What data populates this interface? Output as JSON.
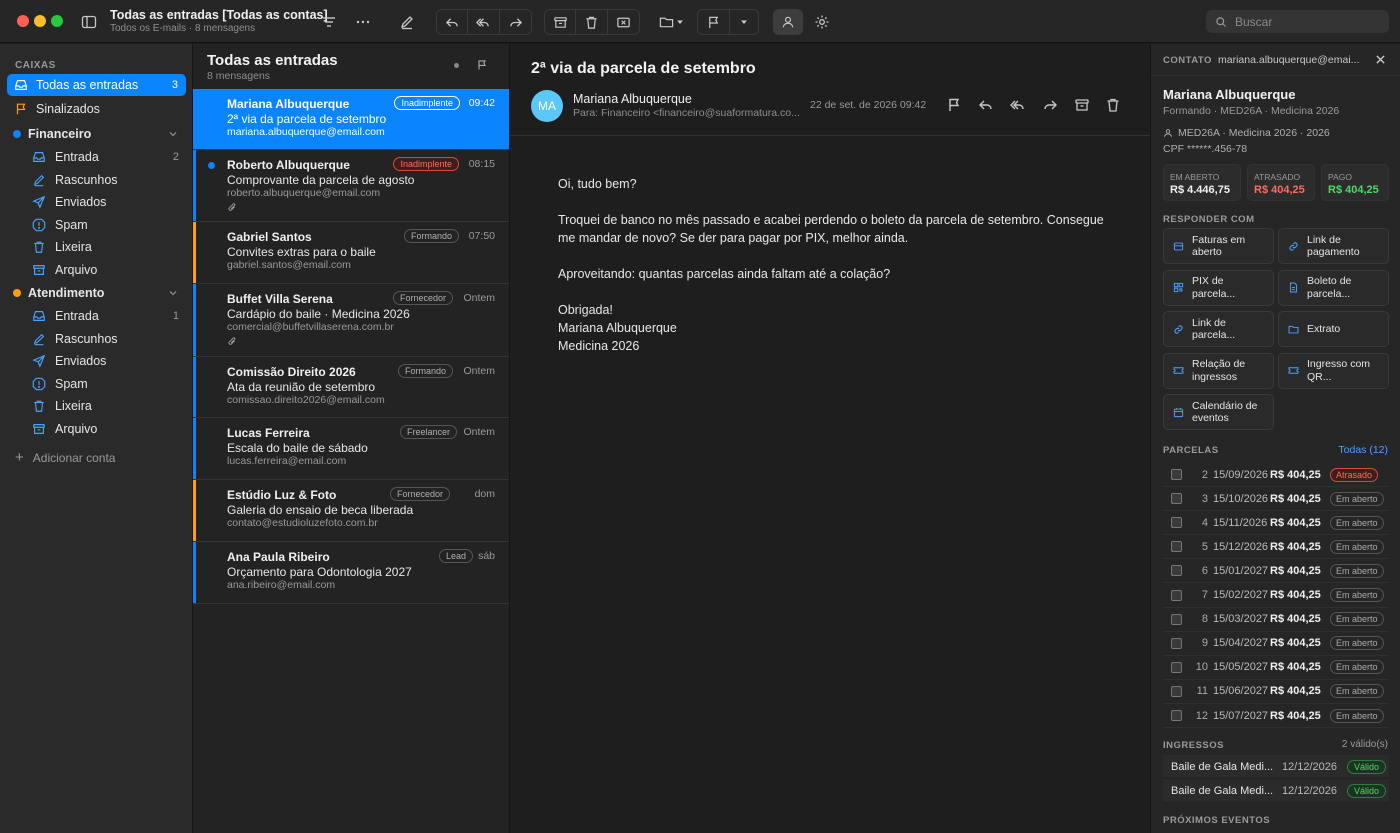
{
  "window": {
    "title": "Todas as entradas [Todas as contas]",
    "subtitle": "Todos os E-mails · 8 mensagens",
    "search_placeholder": "Buscar"
  },
  "colors": {
    "accent": "#0a84ff",
    "financeiro": "#0a84ff",
    "atendimento": "#ff9f0a",
    "danger": "#ff6b5e",
    "success": "#4cd964"
  },
  "sidebar": {
    "section_label": "CAIXAS",
    "all_inboxes": {
      "label": "Todas as entradas",
      "count": "3"
    },
    "flagged": {
      "label": "Sinalizados"
    },
    "accounts": [
      {
        "name": "Financeiro",
        "folders": [
          {
            "label": "Entrada",
            "icon": "inbox-icon",
            "count": "2"
          },
          {
            "label": "Rascunhos",
            "icon": "pencil-icon",
            "count": ""
          },
          {
            "label": "Enviados",
            "icon": "send-icon",
            "count": ""
          },
          {
            "label": "Spam",
            "icon": "spam-icon",
            "count": ""
          },
          {
            "label": "Lixeira",
            "icon": "trash-icon",
            "count": ""
          },
          {
            "label": "Arquivo",
            "icon": "archive-icon",
            "count": ""
          }
        ]
      },
      {
        "name": "Atendimento",
        "folders": [
          {
            "label": "Entrada",
            "icon": "inbox-icon",
            "count": "1"
          },
          {
            "label": "Rascunhos",
            "icon": "pencil-icon",
            "count": ""
          },
          {
            "label": "Enviados",
            "icon": "send-icon",
            "count": ""
          },
          {
            "label": "Spam",
            "icon": "spam-icon",
            "count": ""
          },
          {
            "label": "Lixeira",
            "icon": "trash-icon",
            "count": ""
          },
          {
            "label": "Arquivo",
            "icon": "archive-icon",
            "count": ""
          }
        ]
      }
    ],
    "add_account": "Adicionar conta"
  },
  "list": {
    "title": "Todas as entradas",
    "count": "8 mensagens",
    "messages": [
      {
        "from": "Mariana Albuquerque",
        "subject": "2ª via da parcela de setembro",
        "address": "mariana.albuquerque@email.com",
        "time": "09:42",
        "tag": "Inadimplente",
        "selected": true,
        "unread": false,
        "attachment": false,
        "bar": "#0a84ff"
      },
      {
        "from": "Roberto Albuquerque",
        "subject": "Comprovante da parcela de agosto",
        "address": "roberto.albuquerque@email.com",
        "time": "08:15",
        "tag": "Inadimplente",
        "selected": false,
        "unread": true,
        "attachment": true,
        "bar": "#0a84ff"
      },
      {
        "from": "Gabriel Santos",
        "subject": "Convites extras para o baile",
        "address": "gabriel.santos@email.com",
        "time": "07:50",
        "tag": "Formando",
        "selected": false,
        "unread": false,
        "attachment": false,
        "bar": "#ff9f0a"
      },
      {
        "from": "Buffet Villa Serena",
        "subject": "Cardápio do baile · Medicina 2026",
        "address": "comercial@buffetvillaserena.com.br",
        "time": "Ontem",
        "tag": "Fornecedor",
        "selected": false,
        "unread": false,
        "attachment": true,
        "bar": "#0a84ff"
      },
      {
        "from": "Comissão Direito 2026",
        "subject": "Ata da reunião de setembro",
        "address": "comissao.direito2026@email.com",
        "time": "Ontem",
        "tag": "Formando",
        "selected": false,
        "unread": false,
        "attachment": false,
        "bar": "#0a84ff"
      },
      {
        "from": "Lucas Ferreira",
        "subject": "Escala do baile de sábado",
        "address": "lucas.ferreira@email.com",
        "time": "Ontem",
        "tag": "Freelancer",
        "selected": false,
        "unread": false,
        "attachment": false,
        "bar": "#0a84ff"
      },
      {
        "from": "Estúdio Luz & Foto",
        "subject": "Galeria do ensaio de beca liberada",
        "address": "contato@estudioluzefoto.com.br",
        "time": "dom",
        "tag": "Fornecedor",
        "selected": false,
        "unread": false,
        "attachment": false,
        "bar": "#ff9f0a"
      },
      {
        "from": "Ana Paula Ribeiro",
        "subject": "Orçamento para Odontologia 2027",
        "address": "ana.ribeiro@email.com",
        "time": "sáb",
        "tag": "Lead",
        "selected": false,
        "unread": false,
        "attachment": false,
        "bar": "#0a84ff"
      }
    ]
  },
  "reader": {
    "subject": "2ª via da parcela de setembro",
    "avatar": "MA",
    "from": "Mariana Albuquerque",
    "to": "Para: Financeiro <financeiro@suaformatura.co...",
    "date": "22 de set. de 2026 09:42",
    "body": [
      [
        "Oi, tudo bem?"
      ],
      [
        "Troquei de banco no mês passado e acabei perdendo o boleto da parcela de setembro. Consegue",
        "me mandar de novo? Se der para pagar por PIX, melhor ainda."
      ],
      [
        "Aproveitando: quantas parcelas ainda faltam até a colação?"
      ],
      [
        "Obrigada!",
        "Mariana Albuquerque",
        "Medicina 2026"
      ]
    ]
  },
  "panel": {
    "header_label": "CONTATO",
    "header_email": "mariana.albuquerque@emai...",
    "name": "Mariana Albuquerque",
    "role": "Formando · MED26A · Medicina 2026",
    "class_info": "MED26A · Medicina 2026 · 2026",
    "cpf": "CPF ******.456-78",
    "stats": [
      {
        "label": "EM ABERTO",
        "value": "R$ 4.446,75",
        "color": "#f0f0f0"
      },
      {
        "label": "ATRASADO",
        "value": "R$ 404,25",
        "color": "#ff6b5e"
      },
      {
        "label": "PAGO",
        "value": "R$ 404,25",
        "color": "#4cd964"
      }
    ],
    "reply_label": "RESPONDER COM",
    "reply_buttons": [
      {
        "label": "Faturas em aberto",
        "lines": [
          "Faturas em",
          "aberto"
        ],
        "icon": "invoice-icon"
      },
      {
        "label": "Link de pagamento",
        "lines": [
          "Link de",
          "pagamento"
        ],
        "icon": "link-icon"
      },
      {
        "label": "PIX de parcela...",
        "lines": [
          "PIX de",
          "parcela..."
        ],
        "icon": "qr-icon"
      },
      {
        "label": "Boleto de parcela...",
        "lines": [
          "Boleto de",
          "parcela..."
        ],
        "icon": "document-icon"
      },
      {
        "label": "Link de parcela...",
        "lines": [
          "Link de",
          "parcela..."
        ],
        "icon": "link-icon"
      },
      {
        "label": "Extrato",
        "lines": [
          "Extrato"
        ],
        "icon": "folder-icon"
      },
      {
        "label": "Relação de ingressos",
        "lines": [
          "Relação de",
          "ingressos"
        ],
        "icon": "ticket-icon"
      },
      {
        "label": "Ingresso com QR...",
        "lines": [
          "Ingresso com",
          "QR..."
        ],
        "icon": "ticket-icon"
      },
      {
        "label": "Calendário de eventos",
        "lines": [
          "Calendário de",
          "eventos"
        ],
        "icon": "calendar-icon"
      }
    ],
    "installments_label": "PARCELAS",
    "installments_all": "Todas (12)",
    "installments": [
      {
        "n": "2",
        "date": "15/09/2026",
        "value": "R$ 404,25",
        "status": "Atrasado",
        "late": true
      },
      {
        "n": "3",
        "date": "15/10/2026",
        "value": "R$ 404,25",
        "status": "Em aberto",
        "late": false
      },
      {
        "n": "4",
        "date": "15/11/2026",
        "value": "R$ 404,25",
        "status": "Em aberto",
        "late": false
      },
      {
        "n": "5",
        "date": "15/12/2026",
        "value": "R$ 404,25",
        "status": "Em aberto",
        "late": false
      },
      {
        "n": "6",
        "date": "15/01/2027",
        "value": "R$ 404,25",
        "status": "Em aberto",
        "late": false
      },
      {
        "n": "7",
        "date": "15/02/2027",
        "value": "R$ 404,25",
        "status": "Em aberto",
        "late": false
      },
      {
        "n": "8",
        "date": "15/03/2027",
        "value": "R$ 404,25",
        "status": "Em aberto",
        "late": false
      },
      {
        "n": "9",
        "date": "15/04/2027",
        "value": "R$ 404,25",
        "status": "Em aberto",
        "late": false
      },
      {
        "n": "10",
        "date": "15/05/2027",
        "value": "R$ 404,25",
        "status": "Em aberto",
        "late": false
      },
      {
        "n": "11",
        "date": "15/06/2027",
        "value": "R$ 404,25",
        "status": "Em aberto",
        "late": false
      },
      {
        "n": "12",
        "date": "15/07/2027",
        "value": "R$ 404,25",
        "status": "Em aberto",
        "late": false
      }
    ],
    "tickets_label": "INGRESSOS",
    "tickets_count": "2 válido(s)",
    "tickets": [
      {
        "name": "Baile de Gala Medi...",
        "date": "12/12/2026",
        "status": "Válido"
      },
      {
        "name": "Baile de Gala Medi...",
        "date": "12/12/2026",
        "status": "Válido"
      }
    ],
    "events_label": "PRÓXIMOS EVENTOS"
  }
}
